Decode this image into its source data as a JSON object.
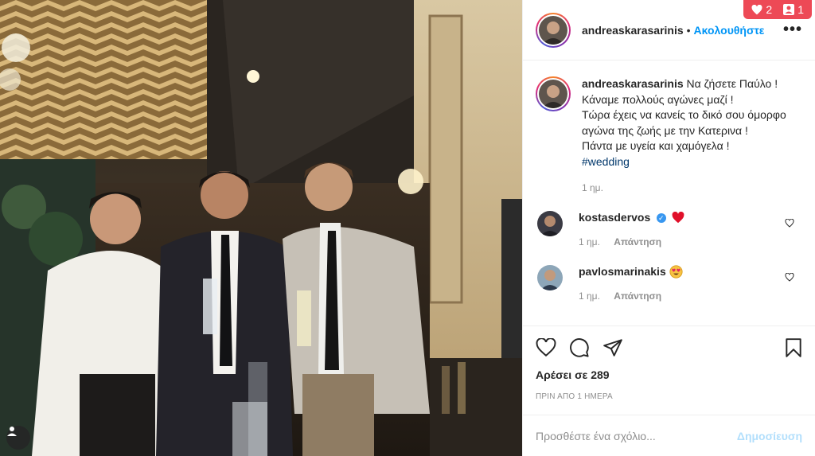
{
  "notifications": {
    "likes": "2",
    "follows": "1"
  },
  "header": {
    "username": "andreaskarasarinis",
    "separator": "•",
    "follow_label": "Ακολουθήστε",
    "more_label": "•••"
  },
  "caption": {
    "username": "andreaskarasarinis",
    "lines": [
      "Να ζήσετε Παύλο !",
      "Κάναμε πολλούς αγώνες μαζί !",
      "Τώρα έχεις να κανείς το δικό σου όμορφο αγώνα της ζωής με την Κατερινα !",
      "Πάντα με υγεία και χαμόγελα !"
    ],
    "hashtag": "#wedding",
    "time": "1 ημ."
  },
  "comments": [
    {
      "username": "kostasdervos",
      "verified": true,
      "emoji": "red-heart",
      "time": "1 ημ.",
      "reply_label": "Απάντηση"
    },
    {
      "username": "pavlosmarinakis",
      "verified": false,
      "emoji": "heart-eyes",
      "time": "1 ημ.",
      "reply_label": "Απάντηση"
    }
  ],
  "likes_text": "Αρέσει σε 289",
  "date_text": "ΠΡΙΝ ΑΠΟ 1 ΗΜΕΡΑ",
  "add_comment": {
    "placeholder": "Προσθέστε ένα σχόλιο...",
    "post_label": "Δημοσίευση"
  },
  "colors": {
    "accent": "#0095f6",
    "notification": "#ed4956",
    "post_disabled": "#b2dffc",
    "like_red": "#ed4956"
  }
}
